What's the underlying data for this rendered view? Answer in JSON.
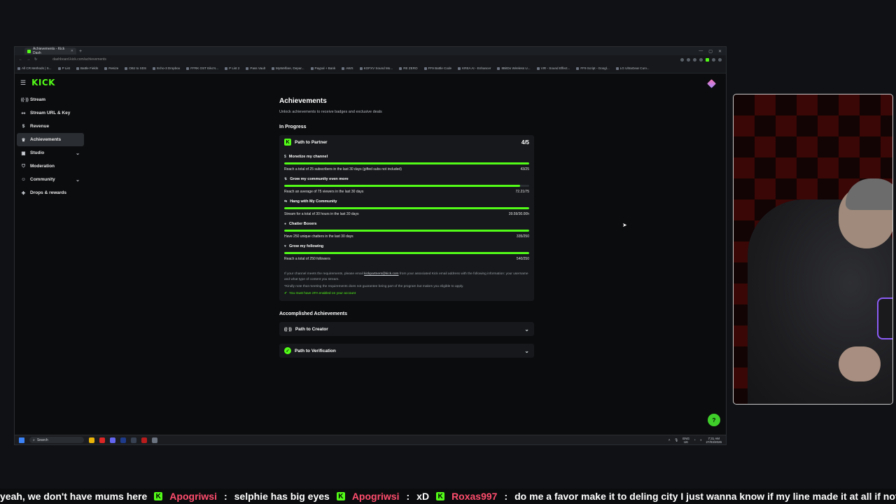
{
  "browser": {
    "tab_title": "Achievements - Kick Dash",
    "new_tab": "+",
    "url": "dashboard.kick.com/achievements",
    "bookmarks": [
      "All CR Methods | S...",
      "P List",
      "Battle Fields",
      "Resize",
      "OBJ to SDS",
      "Echo-3 Dropbox",
      "FFRK OST Eiko's...",
      "P List 2",
      "Pass Vault",
      "MyWelfare, Depar...",
      "Paypal + Bank",
      "AWS",
      "KOFXV Sound Mo...",
      "RE ZERO",
      "FF9 Battle Code",
      "KREA AI - Enhancer",
      "8BitDo Wireless U...",
      "VIR - Sound Effect...",
      "FF9 Script - Googl...",
      "LG UltraGear Curv..."
    ]
  },
  "sidebar": {
    "logo": "KICK",
    "items": [
      {
        "label": "Stream",
        "icon": "signal-icon",
        "glyph": "((·))"
      },
      {
        "label": "Stream URL & Key",
        "icon": "link-icon",
        "glyph": "⚯"
      },
      {
        "label": "Revenue",
        "icon": "dollar-icon",
        "glyph": "$"
      },
      {
        "label": "Achievements",
        "icon": "trophy-icon",
        "glyph": "🏆"
      },
      {
        "label": "Studio",
        "icon": "studio-icon",
        "glyph": "▣"
      },
      {
        "label": "Moderation",
        "icon": "shield-icon",
        "glyph": "⛉"
      },
      {
        "label": "Community",
        "icon": "people-icon",
        "glyph": "☺"
      },
      {
        "label": "Drops & rewards",
        "icon": "gift-icon",
        "glyph": "✚"
      }
    ]
  },
  "main": {
    "title": "Achievements",
    "subtitle": "Unlock achievements to receive badges and exclusive deals",
    "in_progress_label": "In Progress",
    "partner_card": {
      "title": "Path to Partner",
      "score": "4/5",
      "items": [
        {
          "title": "Monetize my channel",
          "desc": "Reach a total of 25 subscribers in the last 30 days (gifted subs not included)",
          "value": "43/25",
          "progress": 1.0
        },
        {
          "title": "Grow my community even more",
          "desc": "Reach an average of 75 viewers in the last 30 days",
          "value": "72.21/75",
          "progress": 0.963
        },
        {
          "title": "Hang with My Community",
          "desc": "Stream for a total of 30 hours in the last 30 days",
          "value": "39.59/30.00h",
          "progress": 1.0
        },
        {
          "title": "Chatter Boxers",
          "desc": "Have 250 unique chatters in the last 30 days",
          "value": "335/250",
          "progress": 1.0
        },
        {
          "title": "Grow my following",
          "desc": "Reach a total of 250 followers",
          "value": "540/250",
          "progress": 1.0
        }
      ],
      "note_pre": "If your channel meets the requirements, please email",
      "note_email": "kickpartners@kick.com",
      "note_post": "from your associated Kick email address with the following information: your username and what type of content you stream.",
      "note2": "*Kindly note that meeting the requirements does not guarantee being part of the program but makes you eligible to apply.",
      "requirement": "You must have 2FA enabled on your account"
    },
    "accomplished_label": "Accomplished Achievements",
    "accomplished": [
      {
        "title": "Path to Creator"
      },
      {
        "title": "Path to Verification"
      }
    ]
  },
  "taskbar": {
    "search": "Search",
    "lang": "ENG",
    "region": "UK",
    "time": "7:31 AM",
    "date": "27/03/2026"
  },
  "ticker": [
    {
      "name": "",
      "text": "yeah, we don't have mums here"
    },
    {
      "name": "Apogriwsi",
      "text": "selphie has big eyes"
    },
    {
      "name": "Apogriwsi",
      "text": "xD"
    },
    {
      "name": "Roxas997",
      "text": "do me a favor make it to deling city I just wanna know if my line made it at all if not it's ok"
    }
  ],
  "colors": {
    "accent": "#53fc18",
    "background": "#0b0c0e",
    "card": "#16181b"
  }
}
